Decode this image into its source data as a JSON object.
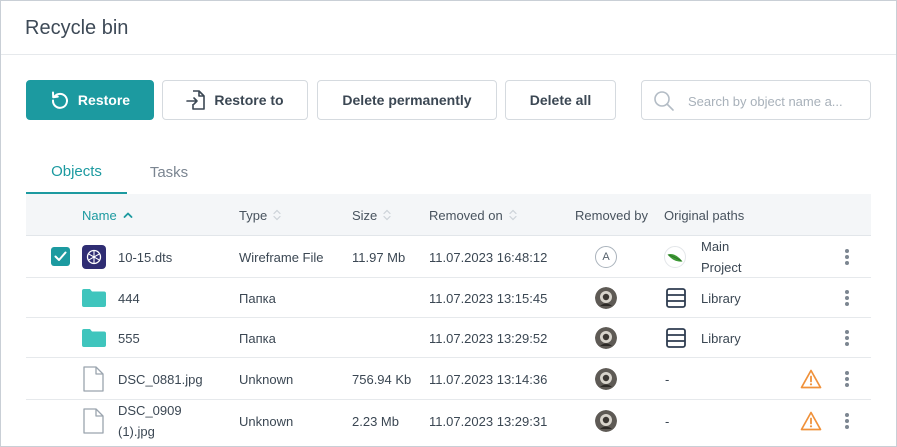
{
  "window": {
    "title": "Recycle bin"
  },
  "toolbar": {
    "restore_label": "Restore",
    "restore_to_label": "Restore to",
    "delete_permanently_label": "Delete permanently",
    "delete_all_label": "Delete all"
  },
  "search": {
    "placeholder": "Search by object name a...",
    "value": ""
  },
  "tabs": [
    {
      "label": "Objects",
      "active": true
    },
    {
      "label": "Tasks",
      "active": false
    }
  ],
  "table": {
    "columns": {
      "name": "Name",
      "type": "Type",
      "size": "Size",
      "removed_on": "Removed on",
      "removed_by": "Removed by",
      "original_paths": "Original paths"
    },
    "sorted_column": "name",
    "sort_direction": "ascending",
    "rows": [
      {
        "name": "10-15.dts",
        "icon": "wireframe-file-icon",
        "type": "Wireframe File",
        "size": "11.97 Mb",
        "removed_on": "11.07.2023 16:48:12",
        "removed_by": {
          "kind": "letter",
          "letter": "A"
        },
        "original_path": {
          "icon": "project-leaf-icon",
          "label": "Main Project"
        },
        "checked": true,
        "warning": false
      },
      {
        "name": "444",
        "icon": "folder-icon",
        "type": "Папка",
        "size": "",
        "removed_on": "11.07.2023 13:15:45",
        "removed_by": {
          "kind": "photo"
        },
        "original_path": {
          "icon": "library-icon",
          "label": "Library"
        },
        "checked": false,
        "warning": false
      },
      {
        "name": "555",
        "icon": "folder-icon",
        "type": "Папка",
        "size": "",
        "removed_on": "11.07.2023 13:29:52",
        "removed_by": {
          "kind": "photo"
        },
        "original_path": {
          "icon": "library-icon",
          "label": "Library"
        },
        "checked": false,
        "warning": false
      },
      {
        "name": "DSC_0881.jpg",
        "icon": "file-icon",
        "type": "Unknown",
        "size": "756.94 Kb",
        "removed_on": "11.07.2023 13:14:36",
        "removed_by": {
          "kind": "photo"
        },
        "original_path": {
          "icon": "",
          "label": "-"
        },
        "checked": false,
        "warning": true
      },
      {
        "name": "DSC_0909 (1).jpg",
        "icon": "file-icon",
        "type": "Unknown",
        "size": "2.23 Mb",
        "removed_on": "11.07.2023 13:29:31",
        "removed_by": {
          "kind": "photo"
        },
        "original_path": {
          "icon": "",
          "label": "-"
        },
        "checked": false,
        "warning": true
      }
    ]
  },
  "colors": {
    "accent": "#1c9aa0",
    "warning": "#f0913a",
    "wireframe_icon_bg": "#2f2d73",
    "folder": "#3fc5bd"
  }
}
